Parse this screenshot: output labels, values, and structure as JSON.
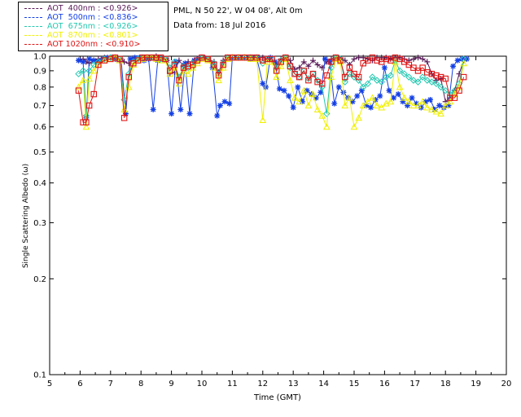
{
  "info": {
    "site": "PML, N 50 22', W 04 08', Alt 0m",
    "date": "Data from: 18 Jul 2016"
  },
  "legend": [
    {
      "label": "AOT  400nm : <0.926>",
      "color": "#5a1c5a"
    },
    {
      "label": "AOT  500nm : <0.836>",
      "color": "#1440e6"
    },
    {
      "label": "AOT  675nm : <0.926>",
      "color": "#22c8b0"
    },
    {
      "label": "AOT  870nm : <0.801>",
      "color": "#f0f000"
    },
    {
      "label": "AOT 1020nm : <0.910>",
      "color": "#e01414"
    }
  ],
  "chart_data": {
    "type": "scatter",
    "title": "",
    "xlabel": "Time (GMT)",
    "ylabel": "Single Scattering Albedo (ω)",
    "xlim": [
      5,
      20
    ],
    "ylim": [
      0.1,
      1.0
    ],
    "yscale": "log",
    "xticks": [
      "5",
      "6",
      "7",
      "8",
      "9",
      "10",
      "11",
      "12",
      "13",
      "14",
      "15",
      "16",
      "17",
      "18",
      "19",
      "20"
    ],
    "yticks": [
      {
        "value": 1.0,
        "label": "1.0"
      },
      {
        "value": 0.9,
        "label": "0.9"
      },
      {
        "value": 0.8,
        "label": "0.8"
      },
      {
        "value": 0.7,
        "label": "0.7"
      },
      {
        "value": 0.6,
        "label": "0.6"
      },
      {
        "value": 0.5,
        "label": "0.5"
      },
      {
        "value": 0.4,
        "label": "0.4"
      },
      {
        "value": 0.3,
        "label": "0.3"
      },
      {
        "value": 0.2,
        "label": "0.2"
      },
      {
        "value": 0.1,
        "label": "0.1"
      }
    ],
    "grid": false,
    "legend_position": "top-left",
    "series": [
      {
        "name": "AOT  400nm : <0.926>",
        "color": "#5a1c5a",
        "marker": "plus",
        "x": [
          5.95,
          6.1,
          6.2,
          6.3,
          6.45,
          6.6,
          6.8,
          7.0,
          7.15,
          7.3,
          7.45,
          7.6,
          7.75,
          7.9,
          8.05,
          8.2,
          8.35,
          8.5,
          8.65,
          8.8,
          8.95,
          9.1,
          9.25,
          9.4,
          9.55,
          9.7,
          9.85,
          10.0,
          10.2,
          10.4,
          10.55,
          10.7,
          10.85,
          11.0,
          11.2,
          11.4,
          11.6,
          11.8,
          12.0,
          12.15,
          12.3,
          12.45,
          12.6,
          12.75,
          12.9,
          13.05,
          13.2,
          13.35,
          13.5,
          13.65,
          13.8,
          13.95,
          14.1,
          14.25,
          14.4,
          14.55,
          14.7,
          14.85,
          15.0,
          15.15,
          15.3,
          15.45,
          15.6,
          15.75,
          15.9,
          16.05,
          16.2,
          16.35,
          16.5,
          16.65,
          16.8,
          16.95,
          17.1,
          17.25,
          17.4,
          17.55,
          17.7,
          17.85,
          18.0,
          18.15,
          18.3,
          18.45,
          18.6
        ],
        "y": [
          0.97,
          0.98,
          0.96,
          0.95,
          0.97,
          0.98,
          0.99,
          0.99,
          0.98,
          0.97,
          0.96,
          0.95,
          0.97,
          0.98,
          0.99,
          0.99,
          0.99,
          1.0,
          0.99,
          0.98,
          0.88,
          0.89,
          0.97,
          0.93,
          0.96,
          0.96,
          0.98,
          0.99,
          0.98,
          0.96,
          0.89,
          0.97,
          0.99,
          0.99,
          0.99,
          0.99,
          0.99,
          0.99,
          0.99,
          0.98,
          0.97,
          0.94,
          0.98,
          0.99,
          0.97,
          0.91,
          0.92,
          0.96,
          0.93,
          0.97,
          0.94,
          0.92,
          0.96,
          0.98,
          0.99,
          0.98,
          0.97,
          0.94,
          0.98,
          0.99,
          0.99,
          0.98,
          0.97,
          0.99,
          0.99,
          0.99,
          0.98,
          0.99,
          0.99,
          0.98,
          0.97,
          0.98,
          0.99,
          0.98,
          0.96,
          0.88,
          0.84,
          0.85,
          0.72,
          0.74,
          0.78,
          0.88,
          0.97
        ]
      },
      {
        "name": "AOT  500nm : <0.836>",
        "color": "#1440e6",
        "marker": "asterisk",
        "x": [
          5.95,
          6.1,
          6.2,
          6.3,
          6.45,
          6.6,
          6.75,
          6.9,
          7.05,
          7.2,
          7.35,
          7.5,
          7.65,
          7.8,
          7.95,
          8.1,
          8.25,
          8.4,
          8.55,
          8.7,
          8.85,
          9.0,
          9.15,
          9.3,
          9.45,
          9.6,
          9.75,
          9.9,
          10.05,
          10.2,
          10.35,
          10.5,
          10.6,
          10.75,
          10.9,
          11.0,
          11.2,
          11.4,
          11.6,
          11.8,
          12.0,
          12.1,
          12.25,
          12.4,
          12.55,
          12.7,
          12.85,
          13.0,
          13.15,
          13.3,
          13.45,
          13.6,
          13.75,
          13.9,
          14.05,
          14.2,
          14.35,
          14.5,
          14.65,
          14.8,
          14.95,
          15.1,
          15.25,
          15.4,
          15.55,
          15.7,
          15.85,
          16.0,
          16.15,
          16.3,
          16.45,
          16.6,
          16.75,
          16.9,
          17.05,
          17.2,
          17.35,
          17.5,
          17.65,
          17.8,
          17.95,
          18.1,
          18.25,
          18.4,
          18.55,
          18.7
        ],
        "y": [
          0.97,
          0.96,
          0.64,
          0.98,
          0.97,
          0.96,
          0.98,
          0.99,
          0.99,
          0.98,
          0.97,
          0.66,
          0.98,
          0.99,
          0.99,
          0.97,
          0.98,
          0.68,
          0.97,
          0.98,
          0.97,
          0.66,
          0.96,
          0.68,
          0.95,
          0.66,
          0.97,
          0.98,
          0.99,
          0.98,
          0.92,
          0.65,
          0.7,
          0.72,
          0.71,
          0.99,
          0.99,
          0.99,
          0.98,
          0.99,
          0.82,
          0.8,
          0.99,
          0.96,
          0.79,
          0.78,
          0.75,
          0.69,
          0.8,
          0.72,
          0.78,
          0.76,
          0.74,
          0.77,
          0.98,
          0.96,
          0.71,
          0.8,
          0.77,
          0.74,
          0.72,
          0.75,
          0.78,
          0.7,
          0.69,
          0.73,
          0.75,
          0.92,
          0.78,
          0.74,
          0.76,
          0.72,
          0.7,
          0.74,
          0.71,
          0.69,
          0.72,
          0.73,
          0.68,
          0.7,
          0.69,
          0.7,
          0.93,
          0.97,
          0.98,
          0.98
        ]
      },
      {
        "name": "AOT  675nm : <0.926>",
        "color": "#22c8b0",
        "marker": "diamond",
        "x": [
          5.95,
          6.1,
          6.2,
          6.3,
          6.45,
          6.6,
          6.8,
          7.0,
          7.15,
          7.3,
          7.45,
          7.6,
          7.75,
          7.9,
          8.05,
          8.2,
          8.35,
          8.5,
          8.65,
          8.8,
          8.95,
          9.1,
          9.25,
          9.4,
          9.55,
          9.7,
          9.85,
          10.0,
          10.2,
          10.4,
          10.55,
          10.7,
          10.85,
          11.0,
          11.2,
          11.4,
          11.6,
          11.8,
          12.0,
          12.15,
          12.3,
          12.45,
          12.6,
          12.75,
          12.9,
          13.05,
          13.2,
          13.35,
          13.5,
          13.65,
          13.8,
          13.95,
          14.1,
          14.25,
          14.4,
          14.55,
          14.7,
          14.85,
          15.0,
          15.15,
          15.3,
          15.45,
          15.6,
          15.75,
          15.9,
          16.05,
          16.2,
          16.35,
          16.5,
          16.65,
          16.8,
          16.95,
          17.1,
          17.25,
          17.4,
          17.55,
          17.7,
          17.85,
          18.0,
          18.15,
          18.3,
          18.45,
          18.6
        ],
        "y": [
          0.88,
          0.9,
          0.65,
          0.9,
          0.94,
          0.96,
          0.98,
          0.99,
          0.99,
          0.98,
          0.73,
          0.88,
          0.96,
          0.98,
          0.99,
          0.99,
          0.99,
          0.99,
          0.98,
          0.98,
          0.92,
          0.96,
          0.86,
          0.93,
          0.92,
          0.95,
          0.97,
          0.99,
          0.98,
          0.95,
          0.88,
          0.95,
          0.99,
          0.99,
          0.99,
          0.99,
          0.99,
          0.99,
          0.95,
          0.98,
          0.98,
          0.92,
          0.97,
          0.99,
          0.92,
          0.88,
          0.86,
          0.9,
          0.85,
          0.88,
          0.84,
          0.8,
          0.66,
          0.92,
          0.99,
          0.98,
          0.83,
          0.88,
          0.86,
          0.84,
          0.8,
          0.82,
          0.86,
          0.84,
          0.83,
          0.86,
          0.87,
          0.97,
          0.9,
          0.88,
          0.86,
          0.84,
          0.83,
          0.86,
          0.84,
          0.83,
          0.82,
          0.8,
          0.78,
          0.76,
          0.78,
          0.82,
          0.98
        ]
      },
      {
        "name": "AOT  870nm : <0.801>",
        "color": "#f0f000",
        "marker": "triangle",
        "x": [
          5.95,
          6.1,
          6.2,
          6.3,
          6.45,
          6.6,
          6.8,
          7.0,
          7.15,
          7.3,
          7.45,
          7.6,
          7.75,
          7.9,
          8.05,
          8.2,
          8.35,
          8.5,
          8.65,
          8.8,
          8.95,
          9.1,
          9.25,
          9.4,
          9.55,
          9.7,
          9.85,
          10.0,
          10.2,
          10.4,
          10.55,
          10.7,
          10.85,
          11.0,
          11.2,
          11.4,
          11.6,
          11.8,
          12.0,
          12.15,
          12.3,
          12.45,
          12.6,
          12.75,
          12.9,
          13.05,
          13.2,
          13.35,
          13.5,
          13.65,
          13.8,
          13.95,
          14.1,
          14.25,
          14.4,
          14.55,
          14.7,
          14.85,
          15.0,
          15.15,
          15.3,
          15.45,
          15.6,
          15.75,
          15.9,
          16.05,
          16.2,
          16.35,
          16.5,
          16.65,
          16.8,
          16.95,
          17.1,
          17.25,
          17.4,
          17.55,
          17.7,
          17.85,
          18.0,
          18.15,
          18.3,
          18.45,
          18.6
        ],
        "y": [
          0.8,
          0.84,
          0.6,
          0.85,
          0.9,
          0.94,
          0.97,
          0.98,
          0.99,
          0.97,
          0.68,
          0.8,
          0.94,
          0.97,
          0.98,
          0.99,
          0.99,
          0.98,
          0.97,
          0.97,
          0.88,
          0.92,
          0.82,
          0.9,
          0.88,
          0.92,
          0.95,
          0.98,
          0.97,
          0.92,
          0.84,
          0.92,
          0.98,
          0.99,
          0.99,
          0.99,
          0.98,
          0.98,
          0.63,
          0.96,
          0.96,
          0.86,
          0.93,
          0.98,
          0.84,
          0.74,
          0.72,
          0.78,
          0.7,
          0.76,
          0.68,
          0.65,
          0.6,
          0.86,
          0.98,
          0.96,
          0.7,
          0.74,
          0.6,
          0.64,
          0.7,
          0.72,
          0.74,
          0.7,
          0.69,
          0.71,
          0.72,
          0.96,
          0.8,
          0.74,
          0.72,
          0.7,
          0.7,
          0.72,
          0.69,
          0.68,
          0.67,
          0.66,
          0.7,
          0.72,
          0.76,
          0.8,
          0.95
        ]
      },
      {
        "name": "AOT 1020nm : <0.910>",
        "color": "#e01414",
        "marker": "square",
        "x": [
          5.95,
          6.1,
          6.2,
          6.3,
          6.45,
          6.6,
          6.8,
          7.0,
          7.15,
          7.3,
          7.45,
          7.6,
          7.75,
          7.9,
          8.05,
          8.2,
          8.35,
          8.5,
          8.65,
          8.8,
          8.95,
          9.1,
          9.25,
          9.4,
          9.55,
          9.7,
          9.85,
          10.0,
          10.2,
          10.4,
          10.55,
          10.7,
          10.85,
          11.0,
          11.2,
          11.4,
          11.6,
          11.8,
          12.0,
          12.15,
          12.3,
          12.45,
          12.6,
          12.75,
          12.9,
          13.05,
          13.2,
          13.35,
          13.5,
          13.65,
          13.8,
          13.95,
          14.1,
          14.25,
          14.4,
          14.55,
          14.7,
          14.85,
          15.0,
          15.15,
          15.3,
          15.45,
          15.6,
          15.75,
          15.9,
          16.05,
          16.2,
          16.35,
          16.5,
          16.65,
          16.8,
          16.95,
          17.1,
          17.25,
          17.4,
          17.55,
          17.7,
          17.85,
          18.0,
          18.15,
          18.3,
          18.45,
          18.6
        ],
        "y": [
          0.78,
          0.62,
          0.62,
          0.7,
          0.76,
          0.94,
          0.97,
          0.98,
          0.99,
          0.98,
          0.64,
          0.86,
          0.95,
          0.97,
          0.99,
          0.99,
          0.99,
          0.99,
          0.99,
          0.98,
          0.9,
          0.94,
          0.84,
          0.92,
          0.93,
          0.94,
          0.97,
          0.99,
          0.98,
          0.94,
          0.87,
          0.94,
          0.99,
          0.99,
          0.99,
          0.99,
          0.99,
          0.99,
          0.97,
          0.98,
          0.98,
          0.9,
          0.96,
          0.99,
          0.93,
          0.88,
          0.86,
          0.9,
          0.84,
          0.88,
          0.83,
          0.82,
          0.87,
          0.96,
          0.99,
          0.97,
          0.86,
          0.92,
          0.88,
          0.86,
          0.95,
          0.97,
          0.99,
          0.97,
          0.96,
          0.98,
          0.97,
          0.99,
          0.98,
          0.96,
          0.94,
          0.92,
          0.9,
          0.92,
          0.89,
          0.88,
          0.87,
          0.86,
          0.85,
          0.74,
          0.74,
          0.78,
          0.86
        ]
      }
    ]
  }
}
